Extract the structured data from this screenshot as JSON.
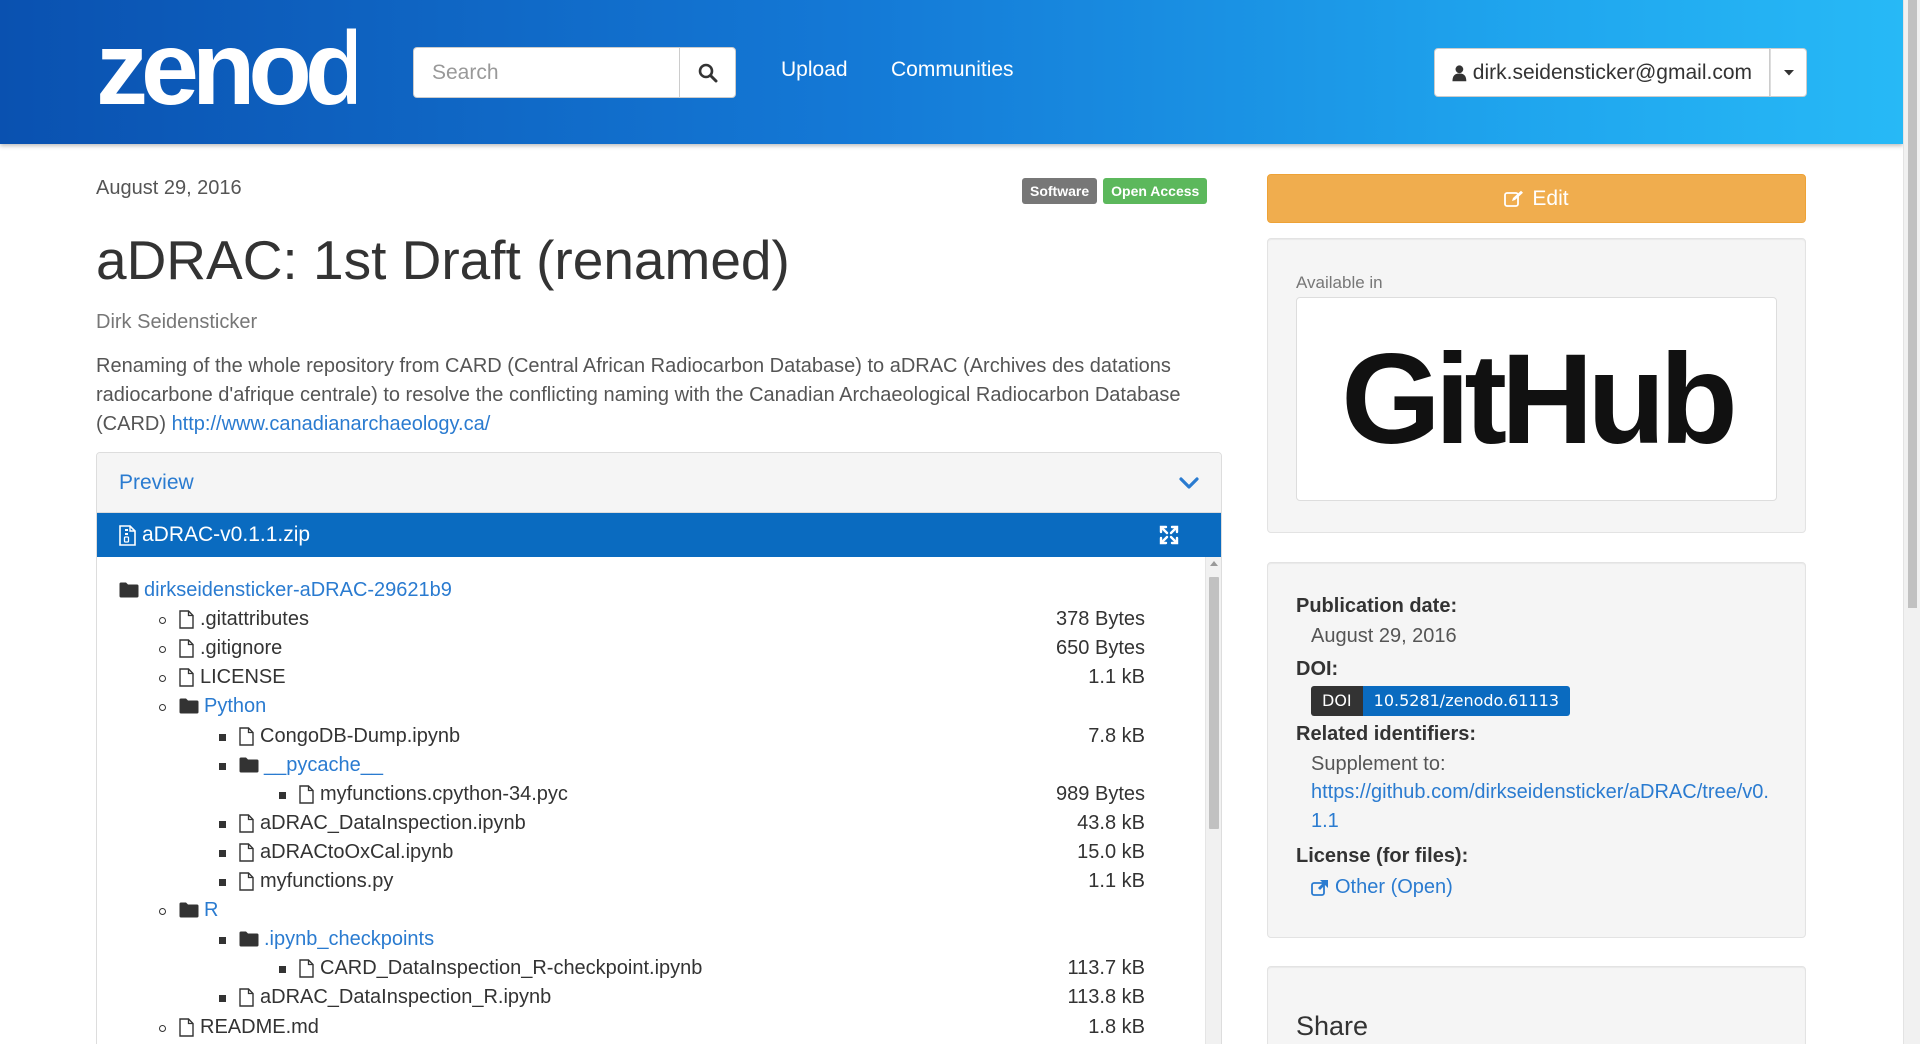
{
  "header": {
    "logo_text": "zenodo",
    "search_placeholder": "Search",
    "nav_upload": "Upload",
    "nav_communities": "Communities",
    "user_email": "dirk.seidensticker@gmail.com"
  },
  "record": {
    "date": "August 29, 2016",
    "badge_type": "Software",
    "badge_access": "Open Access",
    "title": "aDRAC: 1st Draft (renamed)",
    "author": "Dirk Seidensticker",
    "description": "Renaming of the whole repository from CARD (Central African Radiocarbon Database) to aDRAC (Archives des datations radiocarbone d'afrique centrale) to resolve the conflicting naming with the Canadian Archaeological Radiocarbon Database (CARD)",
    "description_link": "http://www.canadianarchaeology.ca/"
  },
  "preview": {
    "label": "Preview",
    "file_name": "aDRAC-v0.1.1.zip",
    "tree": [
      {
        "name": "dirkseidensticker-aDRAC-29621b9",
        "type": "folder",
        "level": 0,
        "size": ""
      },
      {
        "name": ".gitattributes",
        "type": "file",
        "level": 1,
        "size": "378 Bytes"
      },
      {
        "name": ".gitignore",
        "type": "file",
        "level": 1,
        "size": "650 Bytes"
      },
      {
        "name": "LICENSE",
        "type": "file",
        "level": 1,
        "size": "1.1 kB"
      },
      {
        "name": "Python",
        "type": "folder",
        "level": 1,
        "size": ""
      },
      {
        "name": "CongoDB-Dump.ipynb",
        "type": "file",
        "level": 2,
        "size": "7.8 kB"
      },
      {
        "name": "__pycache__",
        "type": "folder",
        "level": 2,
        "size": ""
      },
      {
        "name": "myfunctions.cpython-34.pyc",
        "type": "file",
        "level": 3,
        "size": "989 Bytes"
      },
      {
        "name": "aDRAC_DataInspection.ipynb",
        "type": "file",
        "level": 2,
        "size": "43.8 kB"
      },
      {
        "name": "aDRACtoOxCal.ipynb",
        "type": "file",
        "level": 2,
        "size": "15.0 kB"
      },
      {
        "name": "myfunctions.py",
        "type": "file",
        "level": 2,
        "size": "1.1 kB"
      },
      {
        "name": "R",
        "type": "folder",
        "level": 1,
        "size": ""
      },
      {
        "name": ".ipynb_checkpoints",
        "type": "folder",
        "level": 2,
        "size": ""
      },
      {
        "name": "CARD_DataInspection_R-checkpoint.ipynb",
        "type": "file",
        "level": 3,
        "size": "113.7 kB"
      },
      {
        "name": "aDRAC_DataInspection_R.ipynb",
        "type": "file",
        "level": 2,
        "size": "113.8 kB"
      },
      {
        "name": "README.md",
        "type": "file",
        "level": 1,
        "size": "1.8 kB"
      }
    ]
  },
  "sidebar": {
    "edit_label": "Edit",
    "available_in": "Available in",
    "github_text": "GitHub",
    "publication_date_label": "Publication date:",
    "publication_date": "August 29, 2016",
    "doi_label": "DOI:",
    "doi_prefix": "DOI",
    "doi_value": "10.5281/zenodo.61113",
    "related_label": "Related identifiers:",
    "related_relation": "Supplement to:",
    "related_link": "https://github.com/dirkseidensticker/aDRAC/tree/v0.1.1",
    "license_label": "License (for files):",
    "license_value": "Other (Open)",
    "share_title": "Share"
  },
  "colors": {
    "header_start": "#0a51b0",
    "header_end": "#27b9f6",
    "link": "#2a7bd0",
    "file_bar": "#0a6bc0",
    "edit_button": "#f0ad4e",
    "badge_software": "#777777",
    "badge_open_access": "#5cb85c"
  }
}
